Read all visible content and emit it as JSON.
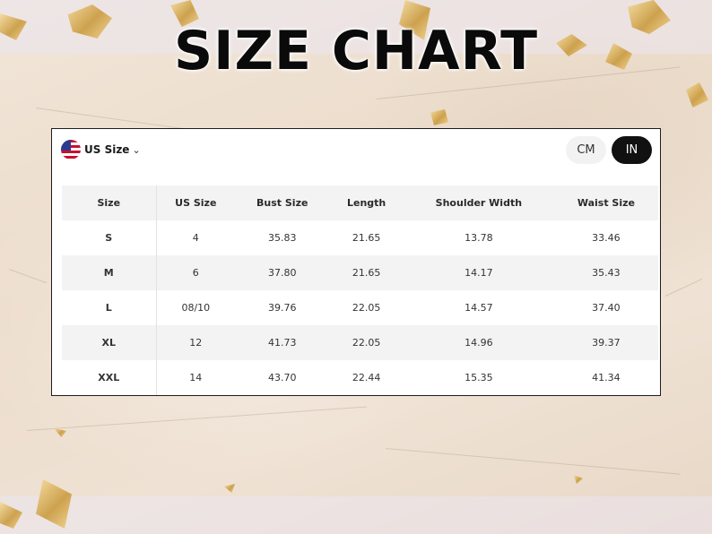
{
  "title": "SIZE CHART",
  "region": {
    "label": "US Size",
    "flag_icon": "us-flag-icon",
    "dropdown_icon": "chevron-down-icon"
  },
  "units": {
    "cm_label": "CM",
    "in_label": "IN",
    "selected": "IN"
  },
  "colors": {
    "title": "#0a0a0a",
    "toggle_active_bg": "#111111",
    "toggle_inactive_bg": "#f2f2f2",
    "row_stripe": "#f3f3f3",
    "gold_flake": "#c99a3e"
  },
  "table": {
    "headers": [
      "Size",
      "US Size",
      "Bust Size",
      "Length",
      "Shoulder Width",
      "Waist Size"
    ],
    "rows": [
      [
        "S",
        "4",
        "35.83",
        "21.65",
        "13.78",
        "33.46"
      ],
      [
        "M",
        "6",
        "37.80",
        "21.65",
        "14.17",
        "35.43"
      ],
      [
        "L",
        "08/10",
        "39.76",
        "22.05",
        "14.57",
        "37.40"
      ],
      [
        "XL",
        "12",
        "41.73",
        "22.05",
        "14.96",
        "39.37"
      ],
      [
        "XXL",
        "14",
        "43.70",
        "22.44",
        "15.35",
        "41.34"
      ]
    ]
  }
}
